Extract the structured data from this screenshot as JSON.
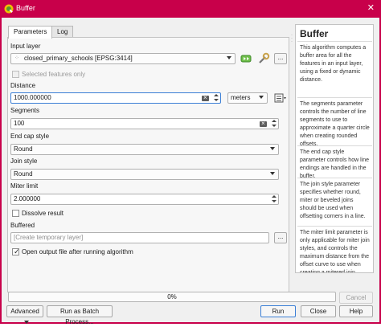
{
  "window": {
    "title": "Buffer",
    "accent_color": "#c8004a"
  },
  "tabs": [
    {
      "label": "Parameters"
    },
    {
      "label": "Log"
    }
  ],
  "form": {
    "input_layer_label": "Input layer",
    "input_layer_value": "closed_primary_schools [EPSG:3414]",
    "input_layer_options_btn": "...",
    "selected_features_label": "Selected features only",
    "distance_label": "Distance",
    "distance_value": "1000.000000",
    "distance_unit": "meters",
    "segments_label": "Segments",
    "segments_value": "100",
    "end_cap_label": "End cap style",
    "end_cap_value": "Round",
    "join_style_label": "Join style",
    "join_style_value": "Round",
    "miter_limit_label": "Miter limit",
    "miter_limit_value": "2.000000",
    "dissolve_label": "Dissolve result",
    "buffered_label": "Buffered",
    "buffered_placeholder": "[Create temporary layer]",
    "buffered_options_btn": "...",
    "open_output_label": "Open output file after running algorithm"
  },
  "help": {
    "title": "Buffer",
    "paragraphs": [
      "This algorithm computes a buffer area for all the features in an input layer, using a fixed or dynamic distance.",
      "The segments parameter controls the number of line segments to use to approximate a quarter circle when creating rounded offsets.",
      "The end cap style parameter controls how line endings are handled in the buffer.",
      "The join style parameter specifies whether round, miter or beveled joins should be used when offsetting corners in a line.",
      "The miter limit parameter is only applicable for miter join styles, and controls the maximum distance from the offset curve to use when creating a mitered join."
    ]
  },
  "progress": {
    "text": "0%",
    "value": 0
  },
  "buttons": {
    "cancel": "Cancel",
    "advanced": "Advanced",
    "batch": "Run as Batch Process...",
    "run": "Run",
    "close": "Close",
    "help": "Help"
  },
  "checks": {
    "selected_features_only": false,
    "dissolve_result": false,
    "open_output": true
  }
}
